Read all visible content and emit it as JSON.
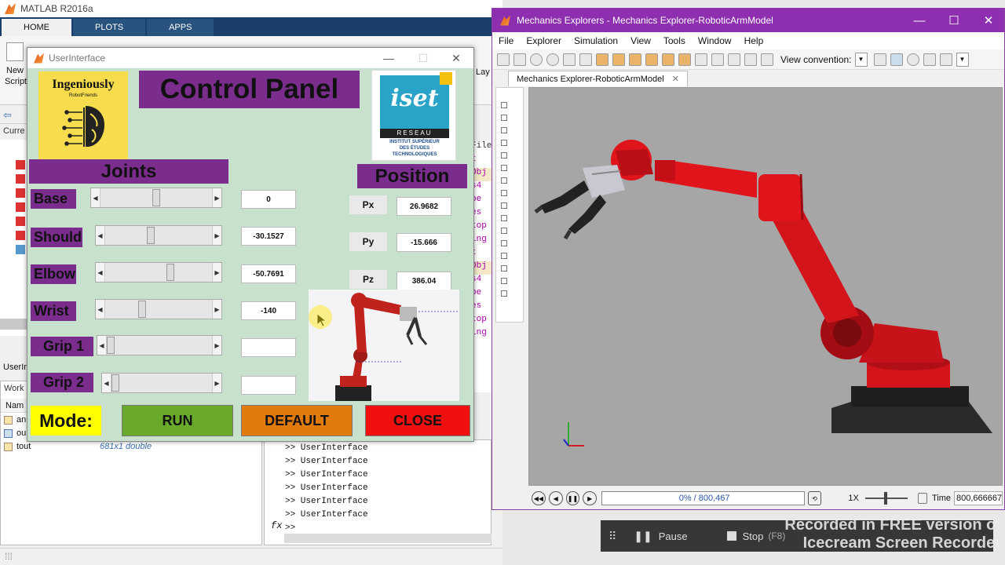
{
  "matlab": {
    "title": "MATLAB R2016a",
    "tabs": [
      "HOME",
      "PLOTS",
      "APPS"
    ],
    "ribbon": {
      "new_label": "New",
      "script_label": "Script",
      "layout_label": "Lay"
    },
    "current_folder_label": "Curre",
    "editor_fragments": [
      "File.m",
      "t",
      "Obj",
      "s4",
      "be",
      "es",
      "top",
      "ing",
      "t",
      "Obj",
      "s4",
      "be",
      "es",
      "top",
      "ing"
    ],
    "panel_userinterface_label": "UserIn",
    "workspace": {
      "label": "Work",
      "name_header": "Nam",
      "rows": [
        {
          "name": "an",
          "value": ""
        },
        {
          "name": "ou",
          "value": ""
        },
        {
          "name": "tout",
          "value": "681x1 double"
        }
      ]
    },
    "command_window": {
      "lines": [
        ">> UserInterface",
        ">> UserInterface",
        ">> UserInterface",
        ">> UserInterface",
        ">> UserInterface",
        ">> UserInterface"
      ],
      "prompt": ">>",
      "fx": "fx"
    }
  },
  "ui": {
    "title": "UserInterface",
    "logo_text": "Ingeniously",
    "logo_sub": "RobotFriends",
    "control_panel_title": "Control Panel",
    "iset": {
      "word": "iset",
      "reseau": "RESEAU",
      "line1": "INSTITUT SUPÉRIEUR",
      "line2": "DES ÉTUDES",
      "line3": "TECHNOLOGIQUES"
    },
    "joints_label": "Joints",
    "position_label": "Position",
    "joints": [
      {
        "label": "Base",
        "value": "0",
        "thumb": 0.5
      },
      {
        "label": "Should",
        "value": "-30.1527",
        "thumb": 0.42
      },
      {
        "label": "Elbow",
        "value": "-50.7691",
        "thumb": 0.62
      },
      {
        "label": "Wrist",
        "value": "-140",
        "thumb": 0.33
      },
      {
        "label": "Grip 1",
        "value": "",
        "thumb": 0.0
      },
      {
        "label": "Grip 2",
        "value": "",
        "thumb": 0.0
      }
    ],
    "positions": [
      {
        "label": "Px",
        "value": "26.9682"
      },
      {
        "label": "Py",
        "value": "-15.666"
      },
      {
        "label": "Pz",
        "value": "386.04"
      }
    ],
    "mode_label": "Mode:",
    "buttons": {
      "run": "RUN",
      "default": "DEFAULT",
      "close": "CLOSE"
    },
    "colors": {
      "bg": "#c8e1cc",
      "purple": "#7b2d8e",
      "yellow": "#f7dd4e",
      "run": "#6aaa2a",
      "default": "#e07a0a",
      "close": "#f01010"
    }
  },
  "mech": {
    "title": "Mechanics Explorers - Mechanics Explorer-RoboticArmModel",
    "menu": [
      "File",
      "Explorer",
      "Simulation",
      "View",
      "Tools",
      "Window",
      "Help"
    ],
    "view_convention_label": "View convention:",
    "tab_label": "Mechanics Explorer-RoboticArmModel",
    "progress_text": "0% / 800,467",
    "progress": 0.0,
    "speed_label": "1X",
    "time_label": "Time",
    "time_value": "800,666667",
    "colors": {
      "title": "#8e2fb0",
      "arm": "#e0141b",
      "view_bg": "#a6a6a6"
    }
  },
  "recorder": {
    "pause_label": "Pause",
    "stop_label": "Stop",
    "stop_key": "(F8)",
    "watermark_line1": "Recorded in FREE version of",
    "watermark_line2": "Icecream Screen Recorder"
  }
}
